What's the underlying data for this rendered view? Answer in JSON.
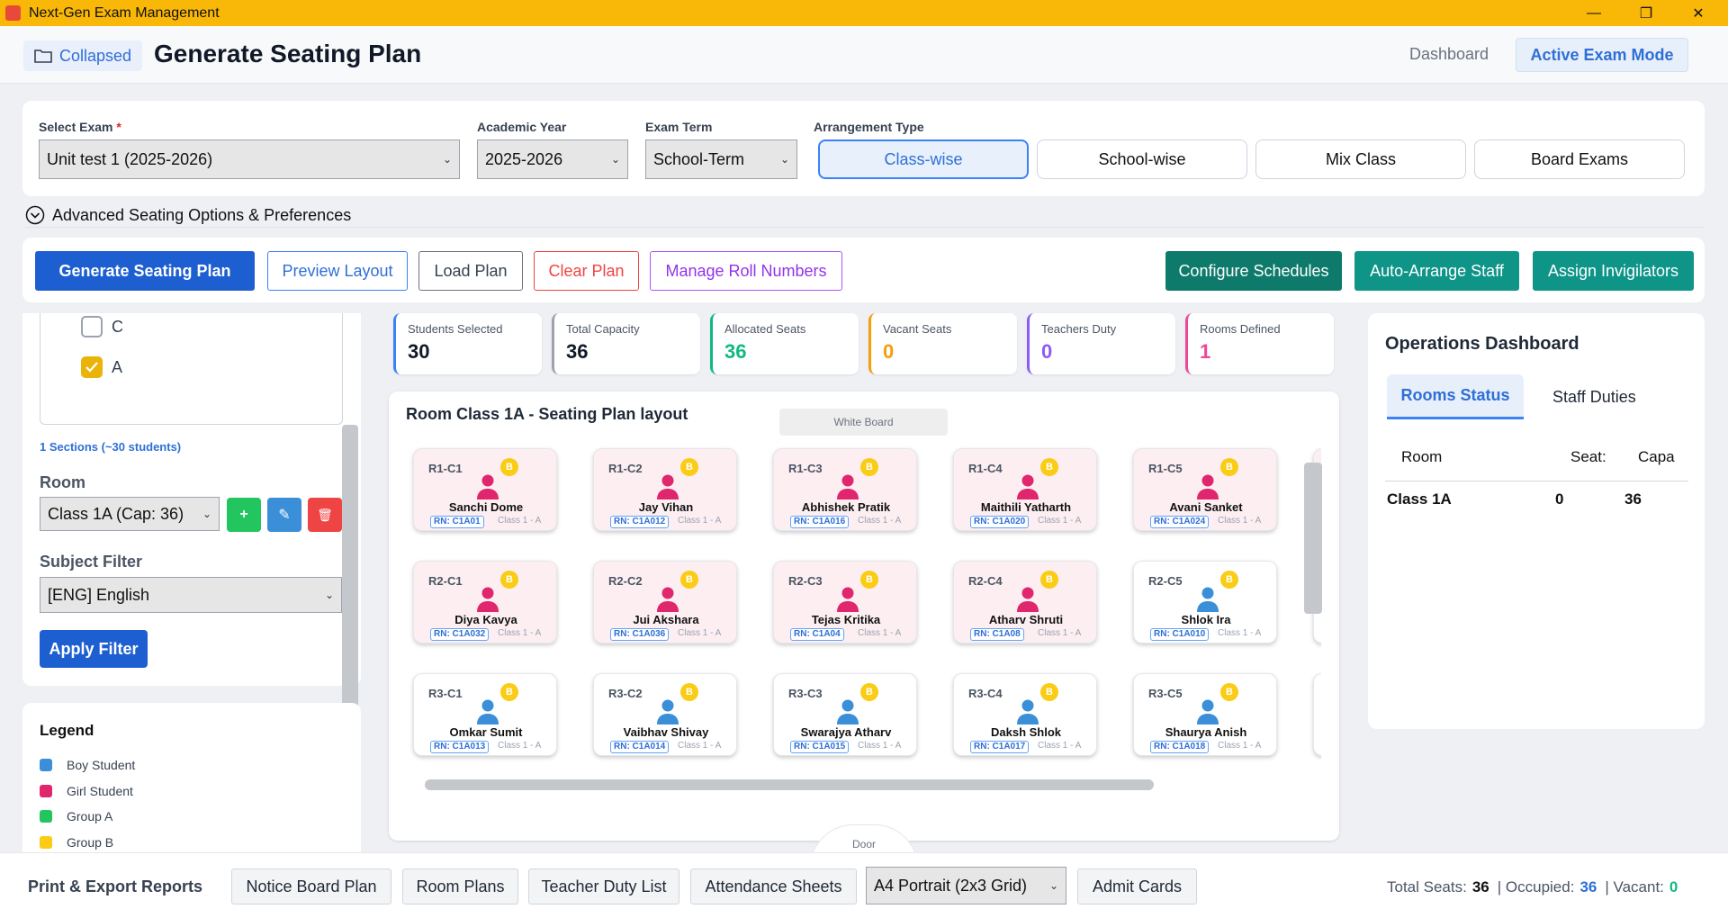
{
  "window": {
    "title": "Next-Gen Exam Management",
    "minimize": "—",
    "restore": "❐",
    "close": "✕"
  },
  "header": {
    "collapsed_label": "Collapsed",
    "page_title": "Generate Seating Plan",
    "nav_dashboard": "Dashboard",
    "nav_active": "Active Exam Mode"
  },
  "filters": {
    "exam_label": "Select Exam",
    "exam_required": "*",
    "exam_value": "Unit test 1 (2025-2026)",
    "year_label": "Academic Year",
    "year_value": "2025-2026",
    "term_label": "Exam Term",
    "term_value": "School-Term",
    "arrangement_label": "Arrangement Type",
    "arrangements": [
      "Class-wise",
      "School-wise",
      "Mix Class",
      "Board Exams"
    ],
    "arrangement_selected": "Class-wise",
    "advanced_label": "Advanced Seating Options & Preferences"
  },
  "actions": {
    "generate": "Generate Seating Plan",
    "preview": "Preview Layout",
    "load": "Load Plan",
    "clear": "Clear Plan",
    "roll": "Manage Roll Numbers",
    "configure": "Configure Schedules",
    "auto": "Auto-Arrange Staff",
    "assign": "Assign Invigilators"
  },
  "sidebar": {
    "sections": [
      {
        "label": "C",
        "checked": false
      },
      {
        "label": "A",
        "checked": true
      }
    ],
    "sections_summary": "1 Sections (~30 students)",
    "room_label": "Room",
    "room_value": "Class 1A (Cap: 36)",
    "room_btn_add": "+",
    "room_btn_edit": "✎",
    "room_btn_delete": "🗑",
    "subject_label": "Subject Filter",
    "subject_value": "[ENG] English",
    "apply_label": "Apply Filter",
    "legend_title": "Legend",
    "legend": [
      {
        "label": "Boy Student",
        "color": "#3b8fd9"
      },
      {
        "label": "Girl Student",
        "color": "#e0266d"
      },
      {
        "label": "Group A",
        "color": "#22c55e"
      },
      {
        "label": "Group B",
        "color": "#facc15"
      }
    ]
  },
  "stats": [
    {
      "title": "Students Selected",
      "value": "30",
      "color": "#3b82f6",
      "vcolor": "#111827"
    },
    {
      "title": "Total Capacity",
      "value": "36",
      "color": "#9ca3af",
      "vcolor": "#111827"
    },
    {
      "title": "Allocated Seats",
      "value": "36",
      "color": "#10b981",
      "vcolor": "#10b981"
    },
    {
      "title": "Vacant Seats",
      "value": "0",
      "color": "#f59e0b",
      "vcolor": "#f59e0b"
    },
    {
      "title": "Teachers Duty",
      "value": "0",
      "color": "#8b5cf6",
      "vcolor": "#8b5cf6"
    },
    {
      "title": "Rooms Defined",
      "value": "1",
      "color": "#ec4899",
      "vcolor": "#ec4899"
    }
  ],
  "layout": {
    "title": "Room Class 1A - Seating Plan layout",
    "whiteboard": "White Board",
    "door": "Door"
  },
  "seats": [
    [
      {
        "code": "R1-C1",
        "name": "Sanchi Dome",
        "rn": "RN: C1A01",
        "cls": "Class 1 - A",
        "gender": "girl",
        "group": "B"
      },
      {
        "code": "R1-C2",
        "name": "Jay Vihan",
        "rn": "RN: C1A012",
        "cls": "Class 1 - A",
        "gender": "girl",
        "group": "B"
      },
      {
        "code": "R1-C3",
        "name": "Abhishek Pratik",
        "rn": "RN: C1A016",
        "cls": "Class 1 - A",
        "gender": "girl",
        "group": "B"
      },
      {
        "code": "R1-C4",
        "name": "Maithili Yatharth",
        "rn": "RN: C1A020",
        "cls": "Class 1 - A",
        "gender": "girl",
        "group": "B"
      },
      {
        "code": "R1-C5",
        "name": "Avani Sanket",
        "rn": "RN: C1A024",
        "cls": "Class 1 - A",
        "gender": "girl",
        "group": "B"
      }
    ],
    [
      {
        "code": "R2-C1",
        "name": "Diya Kavya",
        "rn": "RN: C1A032",
        "cls": "Class 1 - A",
        "gender": "girl",
        "group": "B"
      },
      {
        "code": "R2-C2",
        "name": "Jui Akshara",
        "rn": "RN: C1A036",
        "cls": "Class 1 - A",
        "gender": "girl",
        "group": "B"
      },
      {
        "code": "R2-C3",
        "name": "Tejas Kritika",
        "rn": "RN: C1A04",
        "cls": "Class 1 - A",
        "gender": "girl",
        "group": "B"
      },
      {
        "code": "R2-C4",
        "name": "Atharv Shruti",
        "rn": "RN: C1A08",
        "cls": "Class 1 - A",
        "gender": "girl",
        "group": "B"
      },
      {
        "code": "R2-C5",
        "name": "Shlok Ira",
        "rn": "RN: C1A010",
        "cls": "Class 1 - A",
        "gender": "boy",
        "group": "B"
      }
    ],
    [
      {
        "code": "R3-C1",
        "name": "Omkar Sumit",
        "rn": "RN: C1A013",
        "cls": "Class 1 - A",
        "gender": "boy",
        "group": "B"
      },
      {
        "code": "R3-C2",
        "name": "Vaibhav Shivay",
        "rn": "RN: C1A014",
        "cls": "Class 1 - A",
        "gender": "boy",
        "group": "B"
      },
      {
        "code": "R3-C3",
        "name": "Swarajya Atharv",
        "rn": "RN: C1A015",
        "cls": "Class 1 - A",
        "gender": "boy",
        "group": "B"
      },
      {
        "code": "R3-C4",
        "name": "Daksh Shlok",
        "rn": "RN: C1A017",
        "cls": "Class 1 - A",
        "gender": "boy",
        "group": "B"
      },
      {
        "code": "R3-C5",
        "name": "Shaurya Anish",
        "rn": "RN: C1A018",
        "cls": "Class 1 - A",
        "gender": "boy",
        "group": "B"
      }
    ]
  ],
  "ops": {
    "title": "Operations Dashboard",
    "tab_rooms": "Rooms Status",
    "tab_staff": "Staff Duties",
    "col_room": "Room",
    "col_seats": "Seat:",
    "col_cap": "Capa",
    "row_room": "Class 1A",
    "row_seats": "0",
    "row_cap": "36"
  },
  "footer": {
    "title": "Print & Export Reports",
    "notice": "Notice Board Plan",
    "room_plans": "Room Plans",
    "teacher_duty": "Teacher Duty List",
    "attendance": "Attendance Sheets",
    "paper": "A4 Portrait (2x3 Grid)",
    "admit": "Admit Cards",
    "total_label": "Total Seats:",
    "total": "36",
    "occ_label": "| Occupied:",
    "occ": "36",
    "vac_label": "| Vacant:",
    "vac": "0"
  },
  "colors": {
    "accent": "#2f6fd6",
    "primary": "#1d5fd1",
    "teal": "#0f9488",
    "title_bar": "#f9b707"
  }
}
